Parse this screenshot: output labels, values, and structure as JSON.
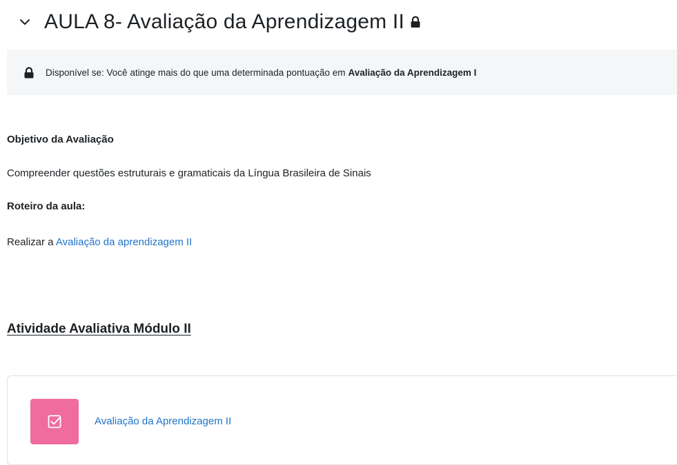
{
  "section": {
    "title": "AULA 8- Avaliação da Aprendizagem II",
    "chevron_icon": "chevron-down-icon",
    "lock_icon": "lock-icon"
  },
  "availability": {
    "prefix": "Disponível se: Você atinge mais do que uma determinada pontuação em",
    "target": "Avaliação da Aprendizagem I",
    "background": "#f5f6f7"
  },
  "content": {
    "objective_heading": "Objetivo da Avaliação",
    "objective_text": "Compreender questões estruturais e gramaticais da Língua Brasileira de Sinais",
    "script_heading": "Roteiro da aula:",
    "script_prefix": "Realizar a",
    "script_link": "Avaliação da aprendizagem II"
  },
  "module": {
    "heading": "Atividade Avaliativa Módulo II"
  },
  "activity": {
    "icon": "quiz-checkbox-icon",
    "icon_color": "#ef6ba0",
    "link": "Avaliação da Aprendizagem II"
  },
  "colors": {
    "link": "#1f74c9",
    "text": "#1d2125"
  }
}
